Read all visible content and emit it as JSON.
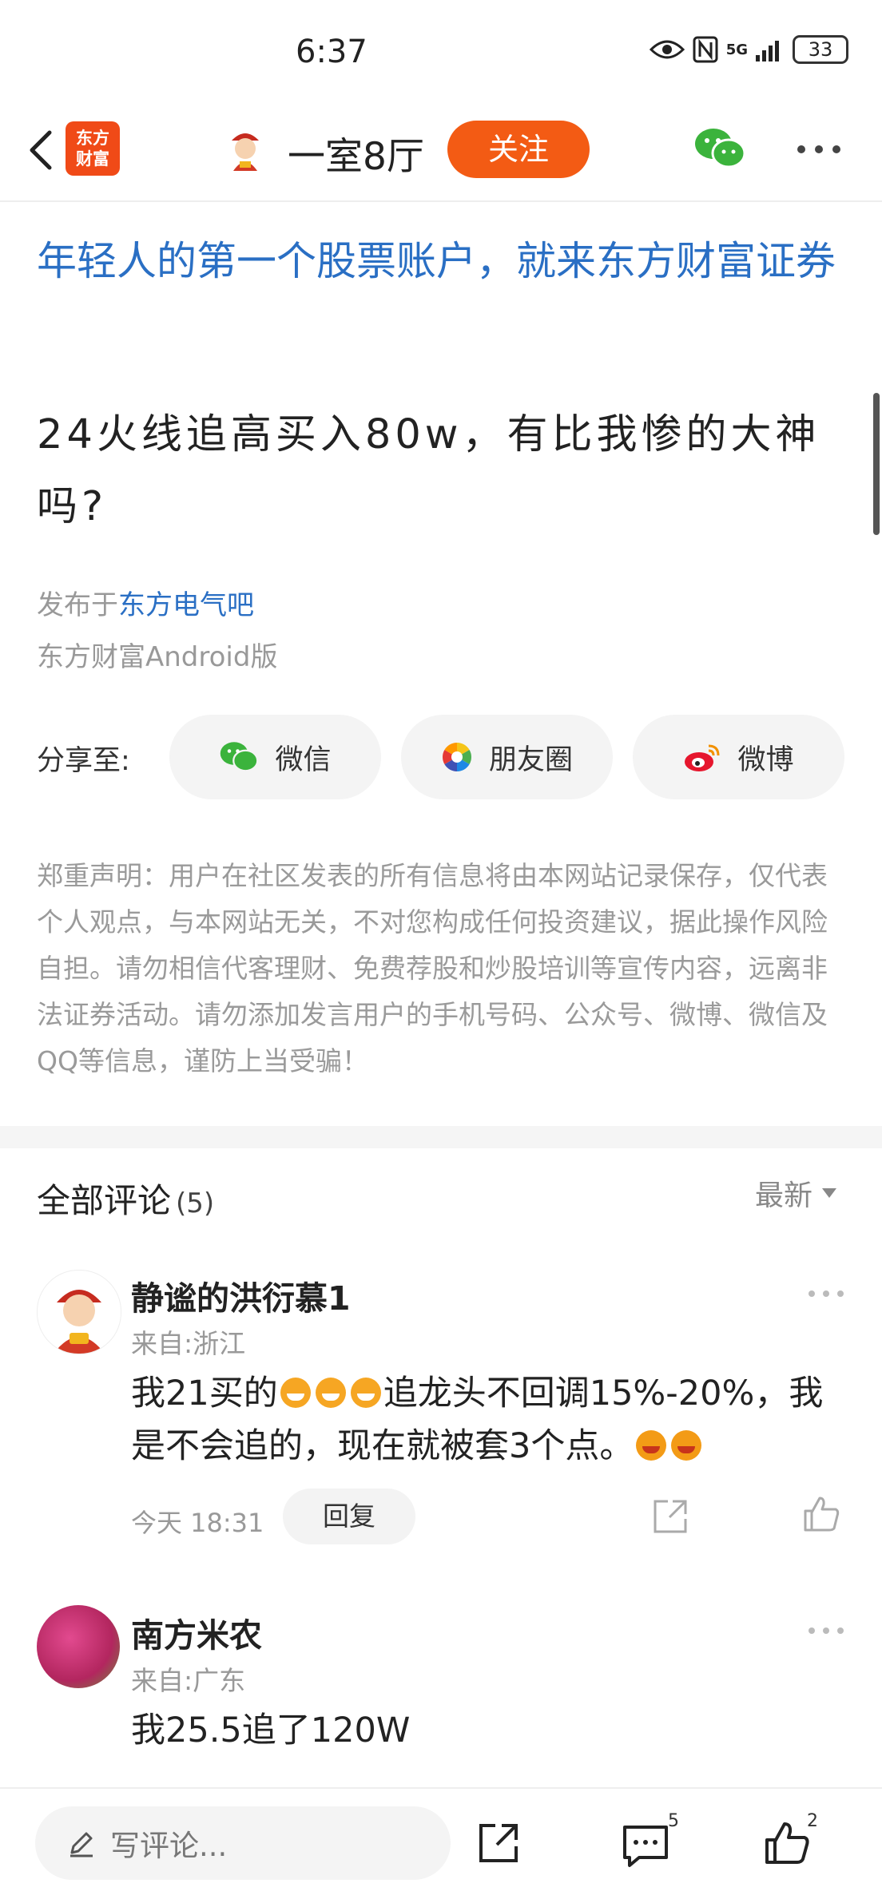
{
  "status_bar": {
    "time": "6:37",
    "network": "5G",
    "battery": "33"
  },
  "header": {
    "logo_line1": "东方",
    "logo_line2": "财富",
    "author_name": "一室8厅",
    "follow_label": "关注"
  },
  "post": {
    "ad_text": "年轻人的第一个股票账户，就来东方财富证券",
    "title": "24火线追高买入80w，有比我惨的大神吗?",
    "published_prefix": "发布于",
    "bar_name": "东方电气吧",
    "source": "东方财富Android版"
  },
  "share": {
    "label": "分享至:",
    "wechat": "微信",
    "moments": "朋友圈",
    "weibo": "微博"
  },
  "disclaimer": "郑重声明：用户在社区发表的所有信息将由本网站记录保存，仅代表个人观点，与本网站无关，不对您构成任何投资建议，据此操作风险自担。请勿相信代客理财、免费荐股和炒股培训等宣传内容，远离非法证券活动。请勿添加发言用户的手机号码、公众号、微博、微信及QQ等信息，谨防上当受骗！",
  "comments": {
    "heading": "全部评论",
    "count": "(5)",
    "sort_label": "最新",
    "items": [
      {
        "name": "静谧的洪衍慕1",
        "location": "来自:浙江",
        "text_a": "我21买的",
        "text_b": "追龙头不回调15%-20%，我是不会追的，现在就被套3个点。",
        "time": "今天 18:31",
        "reply_label": "回复"
      },
      {
        "name": "南方米农",
        "location": "来自:广东",
        "text": "我25.5追了120W"
      }
    ]
  },
  "bottom_bar": {
    "comment_placeholder": "写评论...",
    "comment_count": "5",
    "like_count": "2"
  },
  "colors": {
    "accent_orange": "#f35b14",
    "link_blue": "#2a6fc4",
    "wechat_green": "#3bb33c"
  }
}
